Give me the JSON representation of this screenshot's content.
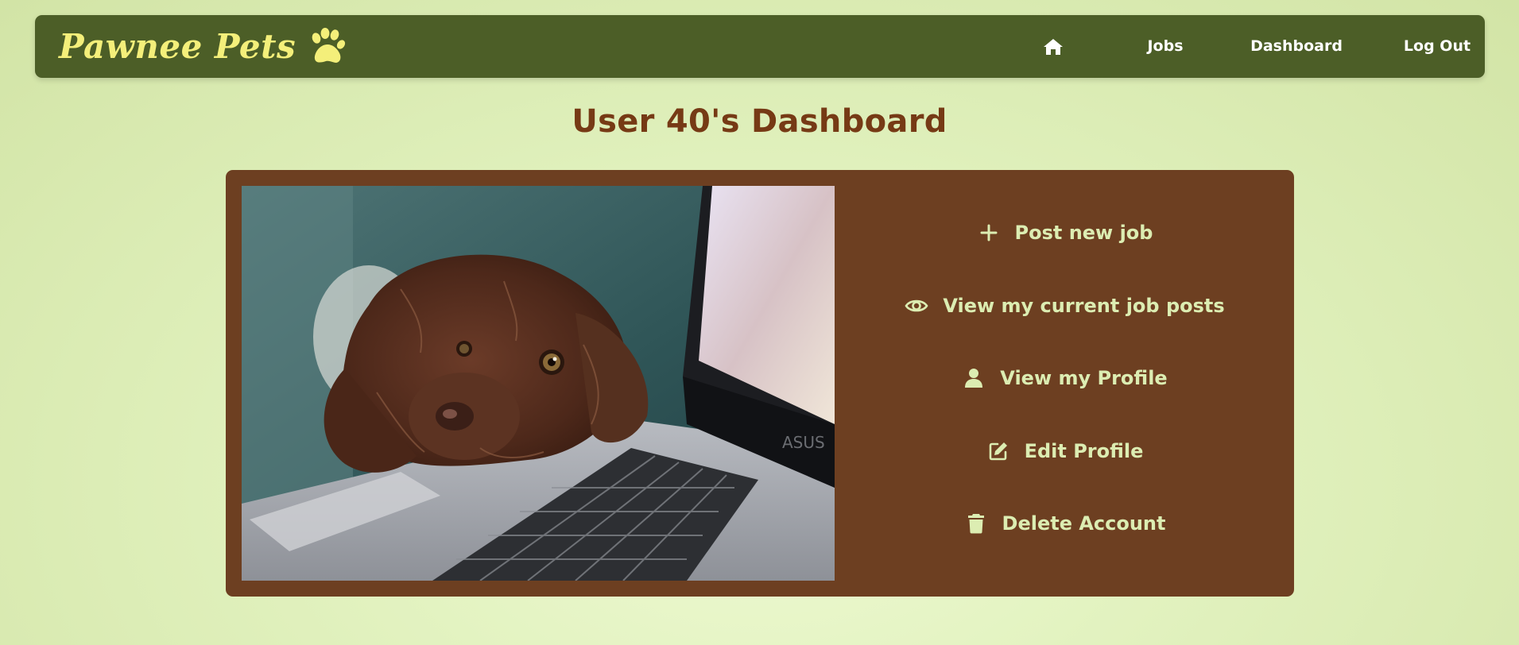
{
  "nav": {
    "brand": "Pawnee Pets",
    "links": {
      "jobs": "Jobs",
      "dashboard": "Dashboard",
      "logout": "Log Out"
    }
  },
  "page": {
    "title": "User 40's Dashboard"
  },
  "actions": [
    {
      "label": "Post new job",
      "icon": "plus-icon"
    },
    {
      "label": "View my current job posts",
      "icon": "eye-icon"
    },
    {
      "label": "View my Profile",
      "icon": "user-icon"
    },
    {
      "label": "Edit Profile",
      "icon": "edit-icon"
    },
    {
      "label": "Delete Account",
      "icon": "trash-icon"
    }
  ],
  "colors": {
    "navbar": "#4c5e27",
    "brand": "#f4ef7a",
    "title": "#763a15",
    "panel": "#6d3f21",
    "action_text": "#dcedb2"
  }
}
